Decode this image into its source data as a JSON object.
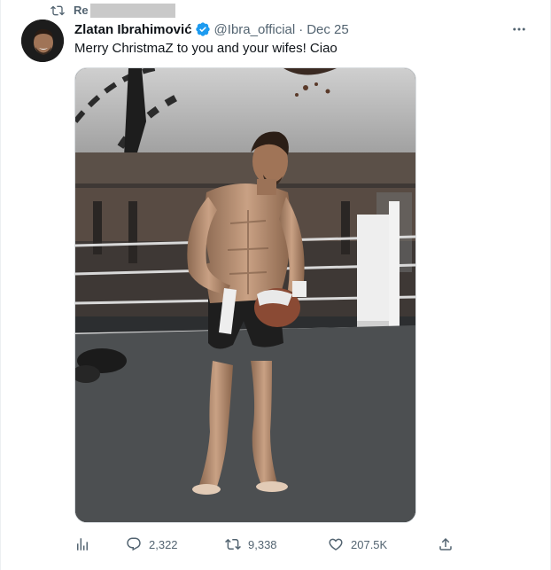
{
  "retweet": {
    "label": "Re",
    "icon": "retweet-icon"
  },
  "author": {
    "name": "Zlatan Ibrahimović",
    "handle": "@Ibra_official",
    "separator": "·",
    "date": "Dec 25",
    "verified": true
  },
  "tweet": {
    "text": "Merry ChristmaZ to you and your wifes! Ciao"
  },
  "media": {
    "alt": ""
  },
  "actions": {
    "views_icon": "analytics-icon",
    "replies": "2,322",
    "retweets": "9,338",
    "likes": "207.5K",
    "share_icon": "share-icon"
  },
  "colors": {
    "text": "#0f1419",
    "muted": "#536471",
    "verified": "#1d9bf0"
  }
}
